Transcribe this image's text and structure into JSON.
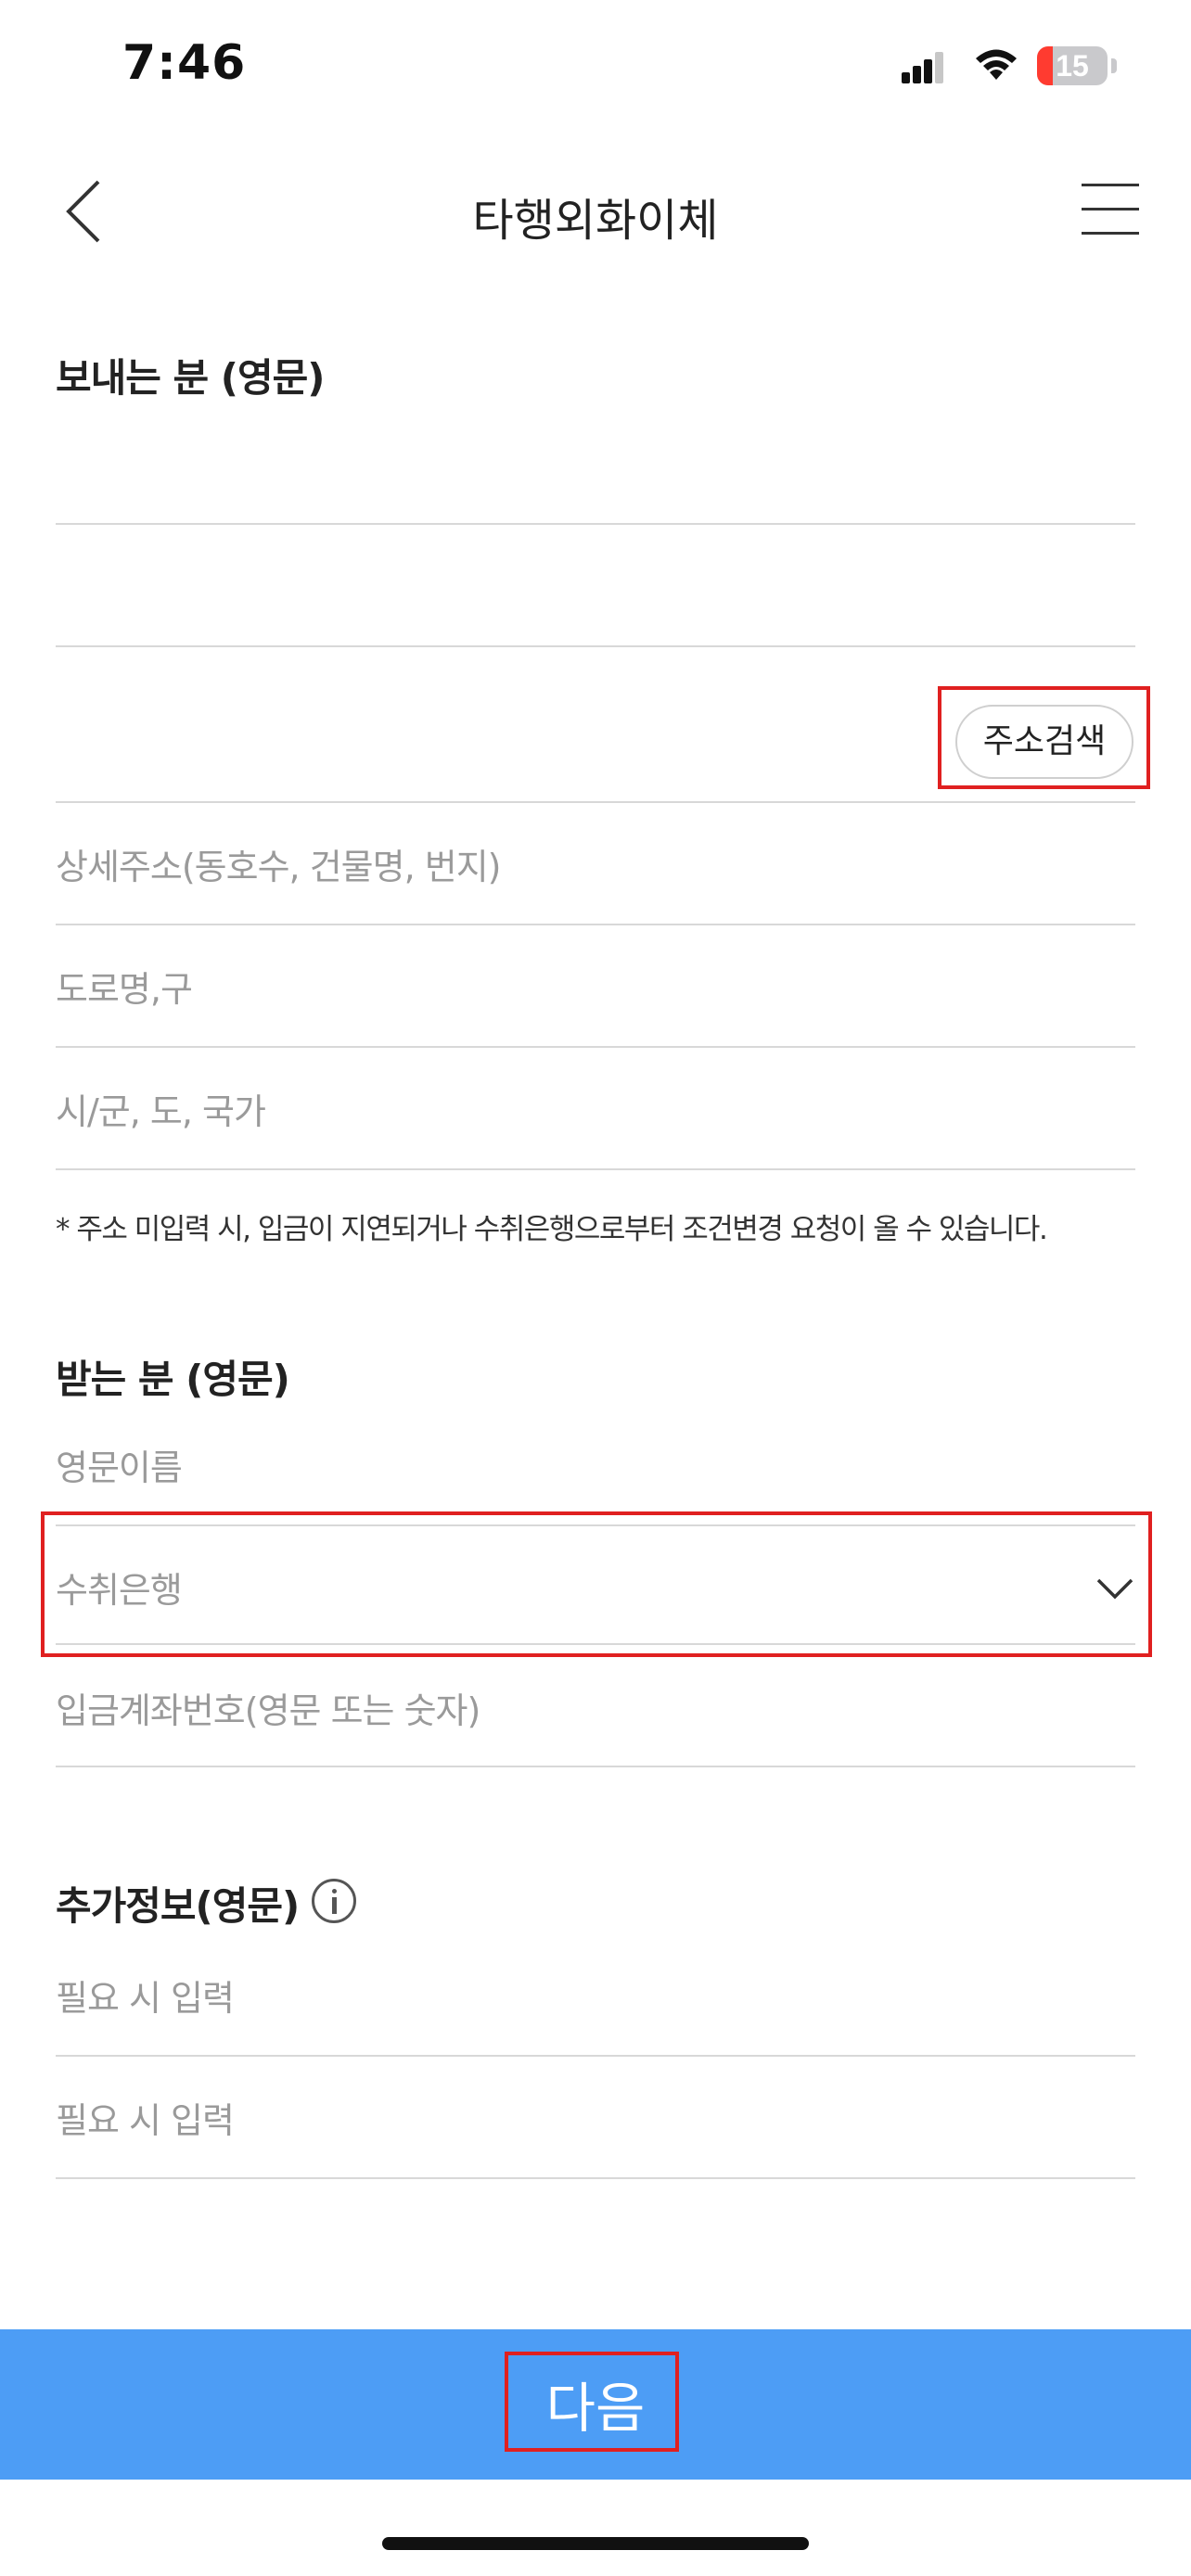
{
  "status_bar": {
    "time": "7:46",
    "battery_level": "15"
  },
  "header": {
    "title": "타행외화이체"
  },
  "sender": {
    "section_title": "보내는 분 (영문)",
    "address_search_label": "주소검색",
    "detail_address_placeholder": "상세주소(동호수, 건물명, 번지)",
    "road_name_placeholder": "도로명,구",
    "city_placeholder": "시/군, 도, 국가",
    "address_note": "* 주소 미입력 시, 입금이 지연되거나 수취은행으로부터 조건변경 요청이 올 수 있습니다."
  },
  "receiver": {
    "section_title": "받는 분 (영문)",
    "english_name_placeholder": "영문이름",
    "bank_placeholder": "수취은행",
    "account_placeholder": "입금계좌번호(영문 또는 숫자)"
  },
  "additional": {
    "section_title": "추가정보(영문)",
    "field1_placeholder": "필요 시 입력",
    "field2_placeholder": "필요 시 입력"
  },
  "footer": {
    "next_label": "다음"
  },
  "colors": {
    "primary_button": "#4d9df5",
    "highlight": "#e02020"
  }
}
